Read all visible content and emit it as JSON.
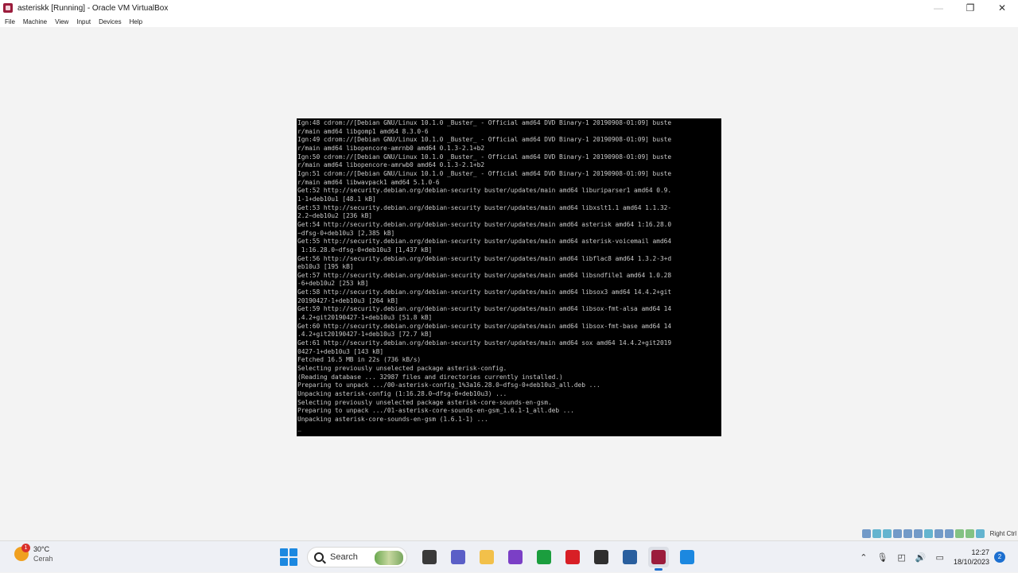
{
  "window": {
    "title": "asteriskk [Running] - Oracle VM VirtualBox",
    "controls": {
      "minimize": "—",
      "restore": "❐",
      "close": "✕"
    }
  },
  "menu": [
    "File",
    "Machine",
    "View",
    "Input",
    "Devices",
    "Help"
  ],
  "console": {
    "lines": [
      "Ign:48 cdrom://[Debian GNU/Linux 10.1.0 _Buster_ - Official amd64 DVD Binary-1 20190908-01:09] buste",
      "r/main amd64 libgomp1 amd64 8.3.0-6",
      "Ign:49 cdrom://[Debian GNU/Linux 10.1.0 _Buster_ - Official amd64 DVD Binary-1 20190908-01:09] buste",
      "r/main amd64 libopencore-amrnb0 amd64 0.1.3-2.1+b2",
      "Ign:50 cdrom://[Debian GNU/Linux 10.1.0 _Buster_ - Official amd64 DVD Binary-1 20190908-01:09] buste",
      "r/main amd64 libopencore-amrwb0 amd64 0.1.3-2.1+b2",
      "Ign:51 cdrom://[Debian GNU/Linux 10.1.0 _Buster_ - Official amd64 DVD Binary-1 20190908-01:09] buste",
      "r/main amd64 libwavpack1 amd64 5.1.0-6",
      "Get:52 http://security.debian.org/debian-security buster/updates/main amd64 liburiparser1 amd64 0.9.",
      "1-1+deb10u1 [48.1 kB]",
      "Get:53 http://security.debian.org/debian-security buster/updates/main amd64 libxslt1.1 amd64 1.1.32-",
      "2.2~deb10u2 [236 kB]",
      "Get:54 http://security.debian.org/debian-security buster/updates/main amd64 asterisk amd64 1:16.28.0",
      "~dfsg-0+deb10u3 [2,385 kB]",
      "Get:55 http://security.debian.org/debian-security buster/updates/main amd64 asterisk-voicemail amd64",
      " 1:16.28.0~dfsg-0+deb10u3 [1,437 kB]",
      "Get:56 http://security.debian.org/debian-security buster/updates/main amd64 libflac8 amd64 1.3.2-3+d",
      "eb10u3 [195 kB]",
      "Get:57 http://security.debian.org/debian-security buster/updates/main amd64 libsndfile1 amd64 1.0.28",
      "-6+deb10u2 [253 kB]",
      "Get:58 http://security.debian.org/debian-security buster/updates/main amd64 libsox3 amd64 14.4.2+git",
      "20190427-1+deb10u3 [264 kB]",
      "Get:59 http://security.debian.org/debian-security buster/updates/main amd64 libsox-fmt-alsa amd64 14",
      ".4.2+git20190427-1+deb10u3 [51.8 kB]",
      "Get:60 http://security.debian.org/debian-security buster/updates/main amd64 libsox-fmt-base amd64 14",
      ".4.2+git20190427-1+deb10u3 [72.7 kB]",
      "Get:61 http://security.debian.org/debian-security buster/updates/main amd64 sox amd64 14.4.2+git2019",
      "0427-1+deb10u3 [143 kB]",
      "Fetched 16.5 MB in 22s (736 kB/s)",
      "Selecting previously unselected package asterisk-config.",
      "(Reading database ... 32987 files and directories currently installed.)",
      "Preparing to unpack .../00-asterisk-config_1%3a16.28.0~dfsg-0+deb10u3_all.deb ...",
      "Unpacking asterisk-config (1:16.28.0~dfsg-0+deb10u3) ...",
      "Selecting previously unselected package asterisk-core-sounds-en-gsm.",
      "Preparing to unpack .../01-asterisk-core-sounds-en-gsm_1.6.1-1_all.deb ...",
      "Unpacking asterisk-core-sounds-en-gsm (1.6.1-1) ...",
      "_"
    ]
  },
  "statusbar": {
    "host_key": "Right Ctrl"
  },
  "taskbar": {
    "weather": {
      "temp": "30°C",
      "condition": "Cerah",
      "badge": "1"
    },
    "search_label": "Search",
    "apps": [
      {
        "name": "file-explorer-icon",
        "color": "#3a3a3a"
      },
      {
        "name": "teams-icon",
        "color": "#5b5fc7"
      },
      {
        "name": "folder-icon",
        "color": "#f2c04a"
      },
      {
        "name": "instagram-icon",
        "color": "#7b3fc6"
      },
      {
        "name": "xbox-icon",
        "color": "#1b9e3e"
      },
      {
        "name": "netflix-icon",
        "color": "#d81f26"
      },
      {
        "name": "chrome-icon",
        "color": "#2f2f2f"
      },
      {
        "name": "virtualbox-manager-icon",
        "color": "#2a5f9e"
      },
      {
        "name": "virtualbox-vm-icon",
        "color": "#9b1c3c"
      },
      {
        "name": "app-store-icon",
        "color": "#1c88e0"
      }
    ],
    "clock": {
      "time": "12:27",
      "date": "18/10/2023"
    },
    "notifications": "2"
  }
}
